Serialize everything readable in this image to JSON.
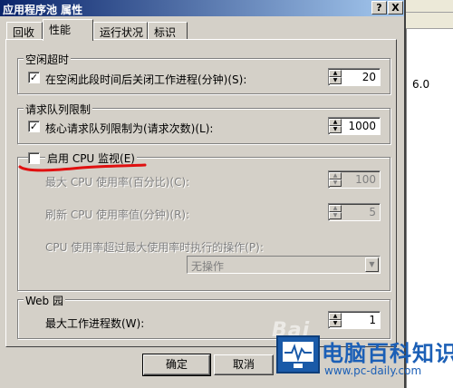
{
  "window": {
    "title": "应用程序池 属性",
    "help_button": "?",
    "close_button": "X"
  },
  "tabs": [
    {
      "label": "回收"
    },
    {
      "label": "性能"
    },
    {
      "label": "运行状况"
    },
    {
      "label": "标识"
    }
  ],
  "idle_timeout": {
    "title": "空闲超时",
    "checkbox_label": "在空闲此段时间后关闭工作进程(分钟)(S):",
    "checked": true,
    "value": "20"
  },
  "request_queue": {
    "title": "请求队列限制",
    "checkbox_label": "核心请求队列限制为(请求次数)(L):",
    "checked": true,
    "value": "1000"
  },
  "cpu_monitor": {
    "checkbox_label": "启用 CPU 监视(E)",
    "checked": false,
    "max_cpu_label": "最大 CPU 使用率(百分比)(C):",
    "max_cpu_value": "100",
    "refresh_label": "刷新 CPU 使用率值(分钟)(R):",
    "refresh_value": "5",
    "action_label": "CPU 使用率超过最大使用率时执行的操作(P):",
    "action_value": "无操作"
  },
  "web_garden": {
    "title": "Web 园",
    "label": "最大工作进程数(W):",
    "value": "1"
  },
  "buttons": {
    "ok": "确定",
    "cancel": "取消"
  },
  "background": {
    "version_text": "6.0"
  },
  "watermark": {
    "brand_cn": "电脑百科知识",
    "brand_url": "www.pc-daily.com",
    "baidu_text": "Bai"
  },
  "colors": {
    "titlebar_start": "#0a246a",
    "annotation_red": "#e01010",
    "brand_blue": "#1b5fb6"
  }
}
